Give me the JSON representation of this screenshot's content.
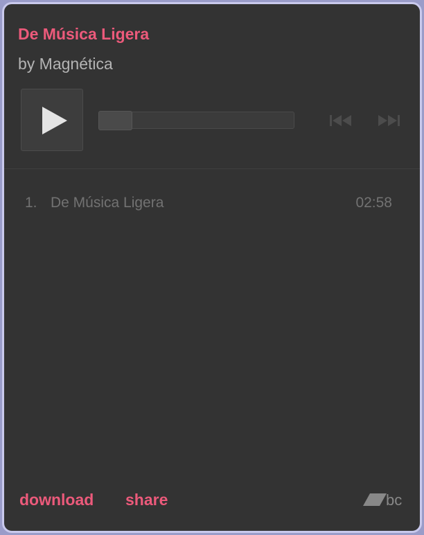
{
  "player": {
    "title": "De Música Ligera",
    "artist_line": "by Magnética",
    "progress": 0.0
  },
  "tracklist": [
    {
      "number": "1.",
      "title": "De Música Ligera",
      "duration": "02:58"
    }
  ],
  "footer": {
    "download_label": "download",
    "share_label": "share",
    "logo_text": "bc"
  },
  "colors": {
    "accent": "#ec5a7b",
    "background": "#333333",
    "border": "#c9c9ec"
  },
  "icons": {
    "play": "play-icon",
    "prev": "previous-track-icon",
    "next": "next-track-icon",
    "logo": "bandcamp-logo-icon"
  }
}
